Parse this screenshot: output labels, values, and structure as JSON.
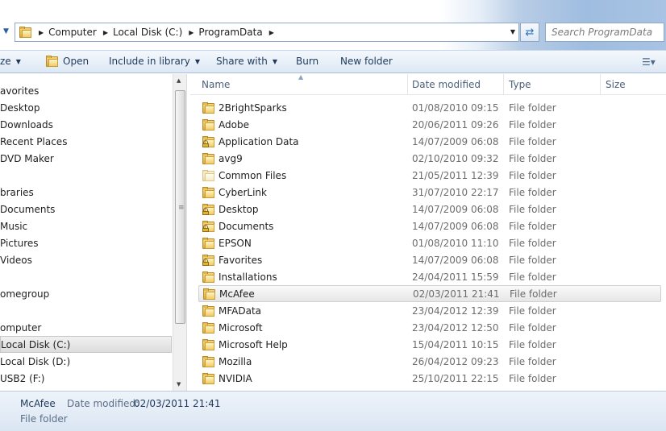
{
  "address": {
    "crumbs": [
      "Computer",
      "Local Disk (C:)",
      "ProgramData"
    ],
    "search_placeholder": "Search ProgramData"
  },
  "toolbar": {
    "organize_label": "ze",
    "open_label": "Open",
    "include_label": "Include in library",
    "share_label": "Share with",
    "burn_label": "Burn",
    "new_folder_label": "New folder"
  },
  "nav": {
    "items": [
      {
        "label": "avorites",
        "kind": "header"
      },
      {
        "label": "Desktop",
        "kind": "item"
      },
      {
        "label": "Downloads",
        "kind": "item"
      },
      {
        "label": "Recent Places",
        "kind": "item"
      },
      {
        "label": "DVD Maker",
        "kind": "item"
      },
      {
        "label": "braries",
        "kind": "header"
      },
      {
        "label": "Documents",
        "kind": "item"
      },
      {
        "label": "Music",
        "kind": "item"
      },
      {
        "label": "Pictures",
        "kind": "item"
      },
      {
        "label": "Videos",
        "kind": "item"
      },
      {
        "label": "omegroup",
        "kind": "header"
      },
      {
        "label": "omputer",
        "kind": "header"
      },
      {
        "label": "Local Disk (C:)",
        "kind": "item",
        "selected": true
      },
      {
        "label": "Local Disk (D:)",
        "kind": "item"
      },
      {
        "label": "USB2 (F:)",
        "kind": "item"
      }
    ]
  },
  "columns": {
    "name": "Name",
    "date": "Date modified",
    "type": "Type",
    "size": "Size"
  },
  "files": [
    {
      "name": "2BrightSparks",
      "date": "01/08/2010 09:15",
      "type": "File folder",
      "icon": "folder-icon"
    },
    {
      "name": "Adobe",
      "date": "20/06/2011 09:26",
      "type": "File folder",
      "icon": "folder-icon"
    },
    {
      "name": "Application Data",
      "date": "14/07/2009 06:08",
      "type": "File folder",
      "icon": "locked-folder-icon"
    },
    {
      "name": "avg9",
      "date": "02/10/2010 09:32",
      "type": "File folder",
      "icon": "folder-icon"
    },
    {
      "name": "Common Files",
      "date": "21/05/2011 12:39",
      "type": "File folder",
      "icon": "empty-folder-icon"
    },
    {
      "name": "CyberLink",
      "date": "31/07/2010 22:17",
      "type": "File folder",
      "icon": "folder-icon"
    },
    {
      "name": "Desktop",
      "date": "14/07/2009 06:08",
      "type": "File folder",
      "icon": "locked-folder-icon"
    },
    {
      "name": "Documents",
      "date": "14/07/2009 06:08",
      "type": "File folder",
      "icon": "locked-folder-icon"
    },
    {
      "name": "EPSON",
      "date": "01/08/2010 11:10",
      "type": "File folder",
      "icon": "folder-icon"
    },
    {
      "name": "Favorites",
      "date": "14/07/2009 06:08",
      "type": "File folder",
      "icon": "locked-folder-icon"
    },
    {
      "name": "Installations",
      "date": "24/04/2011 15:59",
      "type": "File folder",
      "icon": "folder-icon"
    },
    {
      "name": "McAfee",
      "date": "02/03/2011 21:41",
      "type": "File folder",
      "icon": "folder-icon",
      "selected": true
    },
    {
      "name": "MFAData",
      "date": "23/04/2012 12:39",
      "type": "File folder",
      "icon": "folder-icon"
    },
    {
      "name": "Microsoft",
      "date": "23/04/2012 12:50",
      "type": "File folder",
      "icon": "folder-icon"
    },
    {
      "name": "Microsoft Help",
      "date": "15/04/2011 10:15",
      "type": "File folder",
      "icon": "folder-icon"
    },
    {
      "name": "Mozilla",
      "date": "26/04/2012 09:23",
      "type": "File folder",
      "icon": "folder-icon"
    },
    {
      "name": "NVIDIA",
      "date": "25/10/2011 22:15",
      "type": "File folder",
      "icon": "folder-icon"
    }
  ],
  "details": {
    "name": "McAfee",
    "date_label": "Date modified:",
    "date_value": "02/03/2011 21:41",
    "type": "File folder"
  }
}
